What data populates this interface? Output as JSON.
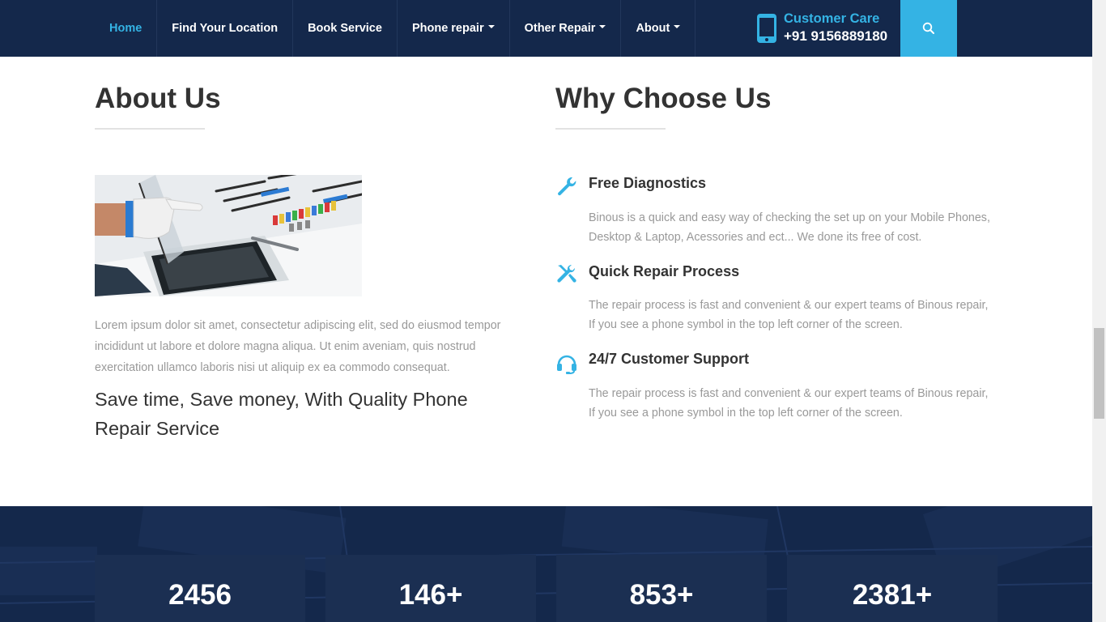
{
  "nav": {
    "items": [
      {
        "label": "Home",
        "active": true,
        "dropdown": false
      },
      {
        "label": "Find Your Location",
        "active": false,
        "dropdown": false
      },
      {
        "label": "Book Service",
        "active": false,
        "dropdown": false
      },
      {
        "label": "Phone repair",
        "active": false,
        "dropdown": true
      },
      {
        "label": "Other Repair",
        "active": false,
        "dropdown": true
      },
      {
        "label": "About",
        "active": false,
        "dropdown": true
      }
    ],
    "customer_care_label": "Customer Care",
    "customer_care_number": "+91 9156889180",
    "search_icon": "search-icon",
    "phone_icon": "mobile-phone-icon"
  },
  "about": {
    "title": "About Us",
    "text": "Lorem ipsum dolor sit amet, consectetur adipiscing elit, sed do eiusmod tempor incididunt ut labore et dolore magna aliqua. Ut enim aveniam, quis nostrud exercitation ullamco laboris nisi ut aliquip ex ea commodo consequat.",
    "tagline": "Save time, Save money, With Quality Phone Repair Service"
  },
  "why": {
    "title": "Why Choose Us",
    "features": [
      {
        "icon": "wrench-icon",
        "title": "Free Diagnostics",
        "desc": "Binous is a quick and easy way of checking the set up on your Mobile Phones, Desktop & Laptop, Acessories and ect... We done its free of cost."
      },
      {
        "icon": "tools-icon",
        "title": "Quick Repair Process",
        "desc": "The repair process is fast and convenient & our expert teams of Binous repair, If you see a phone symbol in the top left corner of the screen."
      },
      {
        "icon": "headset-icon",
        "title": "24/7 Customer Support",
        "desc": "The repair process is fast and convenient & our expert teams of Binous repair, If you see a phone symbol in the top left corner of the screen."
      }
    ]
  },
  "stats": {
    "items": [
      {
        "value": "2456"
      },
      {
        "value": "146+"
      },
      {
        "value": "853+"
      },
      {
        "value": "2381+"
      }
    ]
  },
  "colors": {
    "navy": "#14284b",
    "accent": "#34b3e4",
    "heading": "#333333",
    "muted": "#999999"
  }
}
